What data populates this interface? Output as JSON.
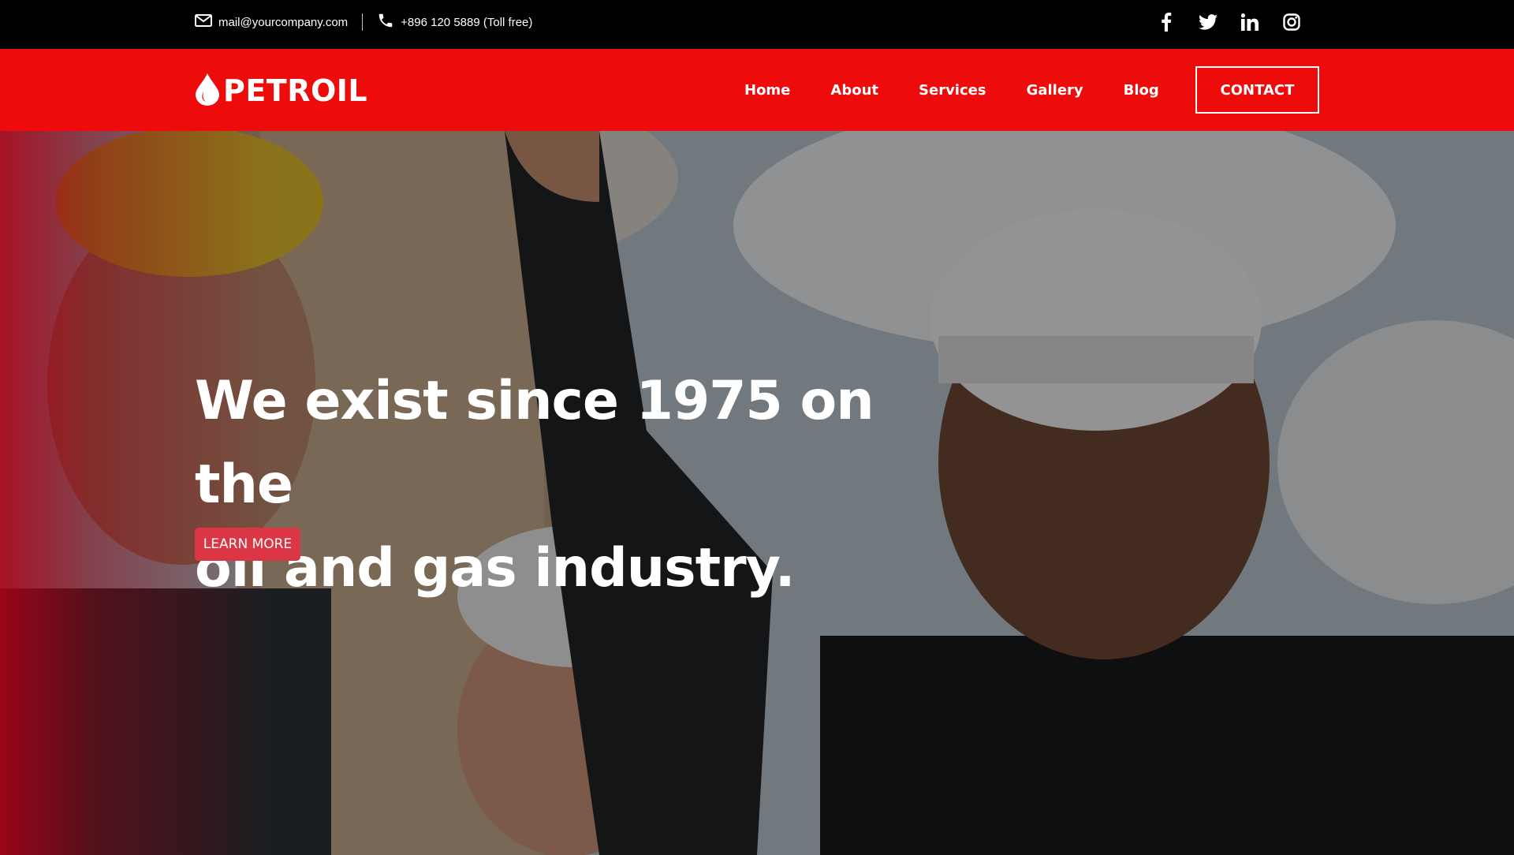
{
  "topbar": {
    "email": "mail@yourcompany.com",
    "phone": "+896 120 5889 (Toll free)",
    "email_icon": "envelope-icon",
    "phone_icon": "phone-icon",
    "social": [
      "facebook-icon",
      "twitter-icon",
      "linkedin-icon",
      "instagram-icon"
    ]
  },
  "nav": {
    "logo_text": "PETROIL",
    "items": [
      "Home",
      "About",
      "Services",
      "Gallery",
      "Blog"
    ],
    "cta": "CONTACT"
  },
  "hero": {
    "title_line1": "We exist since 1975 on the",
    "title_line2": "oil and gas industry.",
    "button": "LEARN MORE"
  },
  "colors": {
    "brand_red": "#ee0b0b",
    "button_red": "#dc3545",
    "topbar": "#000000"
  }
}
